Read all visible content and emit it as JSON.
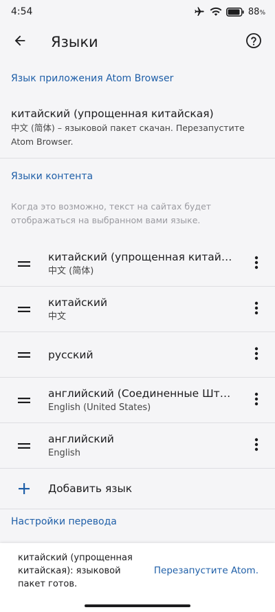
{
  "status_bar": {
    "time": "4:54",
    "battery": "88",
    "battery_unit": "%",
    "icons": [
      "airplane-icon",
      "wifi-icon",
      "battery-icon"
    ]
  },
  "toolbar": {
    "title": "Языки",
    "back_icon": "back-arrow-icon",
    "help_icon": "help-icon"
  },
  "app_language": {
    "header": "Язык приложения Atom Browser",
    "title": "китайский (упрощенная китайская)",
    "subtitle": "中文 (简体) – языковой пакет скачан. Перезапустите Atom Browser."
  },
  "content_languages": {
    "header": "Языки контента",
    "description": "Когда это возможно, текст на сайтах будет отображаться на выбранном вами языке.",
    "items": [
      {
        "name": "китайский (упрощенная китайская)",
        "native": "中文 (简体)"
      },
      {
        "name": "китайский",
        "native": "中文"
      },
      {
        "name": "русский",
        "native": ""
      },
      {
        "name": "английский (Соединенные Штаты)",
        "native": "English (United States)"
      },
      {
        "name": "английский",
        "native": "English"
      }
    ],
    "add_label": "Добавить язык"
  },
  "translation": {
    "header": "Настройки перевода"
  },
  "snackbar": {
    "message": "китайский (упрощенная китайская): языковой пакет готов.",
    "action": "Перезапустите Atom."
  },
  "colors": {
    "accent": "#1f5fa8",
    "background": "#f5f5f7",
    "divider": "#dedee2",
    "hint_text": "#9a9aa0"
  }
}
